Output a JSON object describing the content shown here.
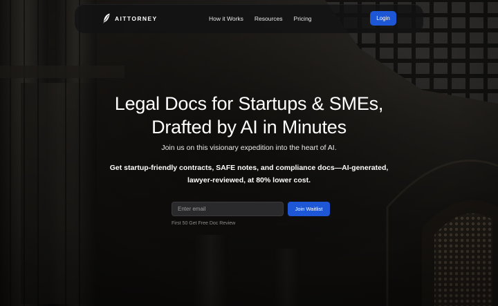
{
  "navbar": {
    "brand_name": "AITTORNEY",
    "links": [
      {
        "label": "How it Works"
      },
      {
        "label": "Resources"
      },
      {
        "label": "Pricing"
      }
    ],
    "login_label": "Login"
  },
  "hero": {
    "title_line1": "Legal Docs for Startups & SMEs,",
    "title_line2": "Drafted by AI in Minutes",
    "subtitle": "Join us on this visionary expedition into the heart of AI.",
    "description": "Get startup-friendly contracts, SAFE notes, and compliance docs—AI-generated, lawyer-reviewed, at 80% lower cost."
  },
  "waitlist": {
    "email_placeholder": "Enter email",
    "email_value": "",
    "join_label": "Join Waitlist",
    "promo_text": "First 50 Get Free Doc Review"
  },
  "colors": {
    "accent": "#1d57d6",
    "navbar_bg": "#121214",
    "input_bg": "#2a2a2c"
  }
}
